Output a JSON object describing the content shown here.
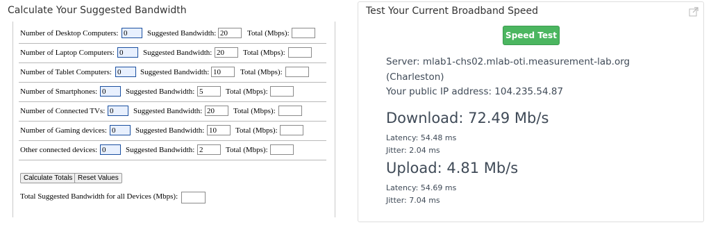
{
  "left": {
    "title": "Calculate Your Suggested Bandwidth",
    "sug_label": "Suggested Bandwidth:",
    "tot_label": "Total (Mbps):",
    "rows": [
      {
        "label": "Number of Desktop Computers:",
        "count": "0",
        "suggested": "20",
        "total": ""
      },
      {
        "label": "Number of Laptop Computers:",
        "count": "0",
        "suggested": "20",
        "total": ""
      },
      {
        "label": "Number of Tablet Computers:",
        "count": "0",
        "suggested": "10",
        "total": ""
      },
      {
        "label": "Number of Smartphones:",
        "count": "0",
        "suggested": "5",
        "total": ""
      },
      {
        "label": "Number of Connected TVs:",
        "count": "0",
        "suggested": "20",
        "total": ""
      },
      {
        "label": "Number of Gaming devices:",
        "count": "0",
        "suggested": "10",
        "total": ""
      },
      {
        "label": "Other connected devices:",
        "count": "0",
        "suggested": "2",
        "total": ""
      }
    ],
    "calculate_label": "Calculate Totals",
    "reset_label": "Reset Values",
    "total_all_label": "Total Suggested Bandwidth for all Devices (Mbps):",
    "total_all_value": ""
  },
  "right": {
    "title": "Test Your Current Broadband Speed",
    "external_icon": "external-link-icon",
    "speed_test_label": "Speed Test",
    "server_line": "Server: mlab1-chs02.mlab-oti.measurement-lab.org",
    "location_line": "(Charleston)",
    "ip_line": "Your public IP address: 104.235.54.87",
    "download_line": "Download: 72.49 Mb/s",
    "download_latency": "Latency: 54.48 ms",
    "download_jitter": "Jitter: 2.04 ms",
    "upload_line": "Upload: 4.81 Mb/s",
    "upload_latency": "Latency: 54.69 ms",
    "upload_jitter": "Jitter: 7.04 ms"
  },
  "colors": {
    "speed_button": "#4bb660",
    "count_input_bg": "#e8f0fe",
    "count_input_border": "#1a4fa0",
    "info_text": "#3f4a57"
  }
}
